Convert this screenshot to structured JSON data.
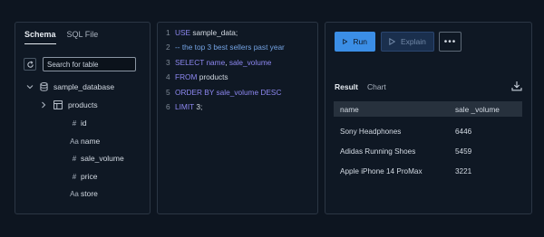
{
  "schema_panel": {
    "tabs": [
      "Schema",
      "SQL File"
    ],
    "search_placeholder": "Search for table",
    "database": "sample_database",
    "table": "products",
    "columns": [
      {
        "prefix": "#",
        "name": "id"
      },
      {
        "prefix": "Aa",
        "name": "name"
      },
      {
        "prefix": "#",
        "name": "sale_volume"
      },
      {
        "prefix": "#",
        "name": "price"
      },
      {
        "prefix": "Aa",
        "name": "store"
      }
    ]
  },
  "editor": {
    "lines": [
      {
        "num": "1",
        "tokens": [
          {
            "t": "USE ",
            "c": "kw"
          },
          {
            "t": "sample_data;",
            "c": "tx"
          }
        ]
      },
      {
        "num": "2",
        "tokens": [
          {
            "t": "-- the top 3 best sellers past year",
            "c": "cm"
          }
        ]
      },
      {
        "num": "3",
        "tokens": [
          {
            "t": "SELECT ",
            "c": "kw"
          },
          {
            "t": "name",
            "c": "kw"
          },
          {
            "t": ", ",
            "c": "tx"
          },
          {
            "t": "sale_volume",
            "c": "kw"
          }
        ]
      },
      {
        "num": "4",
        "tokens": [
          {
            "t": "FROM ",
            "c": "kw"
          },
          {
            "t": "products",
            "c": "tx"
          }
        ]
      },
      {
        "num": "5",
        "tokens": [
          {
            "t": "ORDER BY ",
            "c": "kw"
          },
          {
            "t": "sale_volume ",
            "c": "kw"
          },
          {
            "t": "DESC",
            "c": "kw"
          }
        ]
      },
      {
        "num": "6",
        "tokens": [
          {
            "t": "LIMIT ",
            "c": "kw"
          },
          {
            "t": "3;",
            "c": "tx"
          }
        ]
      }
    ]
  },
  "toolbar": {
    "run_label": "Run",
    "explain_label": "Explain",
    "more_label": "•••"
  },
  "results": {
    "tabs": [
      "Result",
      "Chart"
    ],
    "headers": [
      "name",
      "sale _volume"
    ],
    "rows": [
      [
        "Sony Headphones",
        "6446"
      ],
      [
        "Adidas Running Shoes",
        "5459"
      ],
      [
        "Apple iPhone 14 ProMax",
        "3221"
      ]
    ]
  },
  "colors": {
    "background": "#0d1520",
    "accent": "#3b8ee6",
    "keyword": "#8d87f0",
    "comment": "#74a3e3"
  }
}
